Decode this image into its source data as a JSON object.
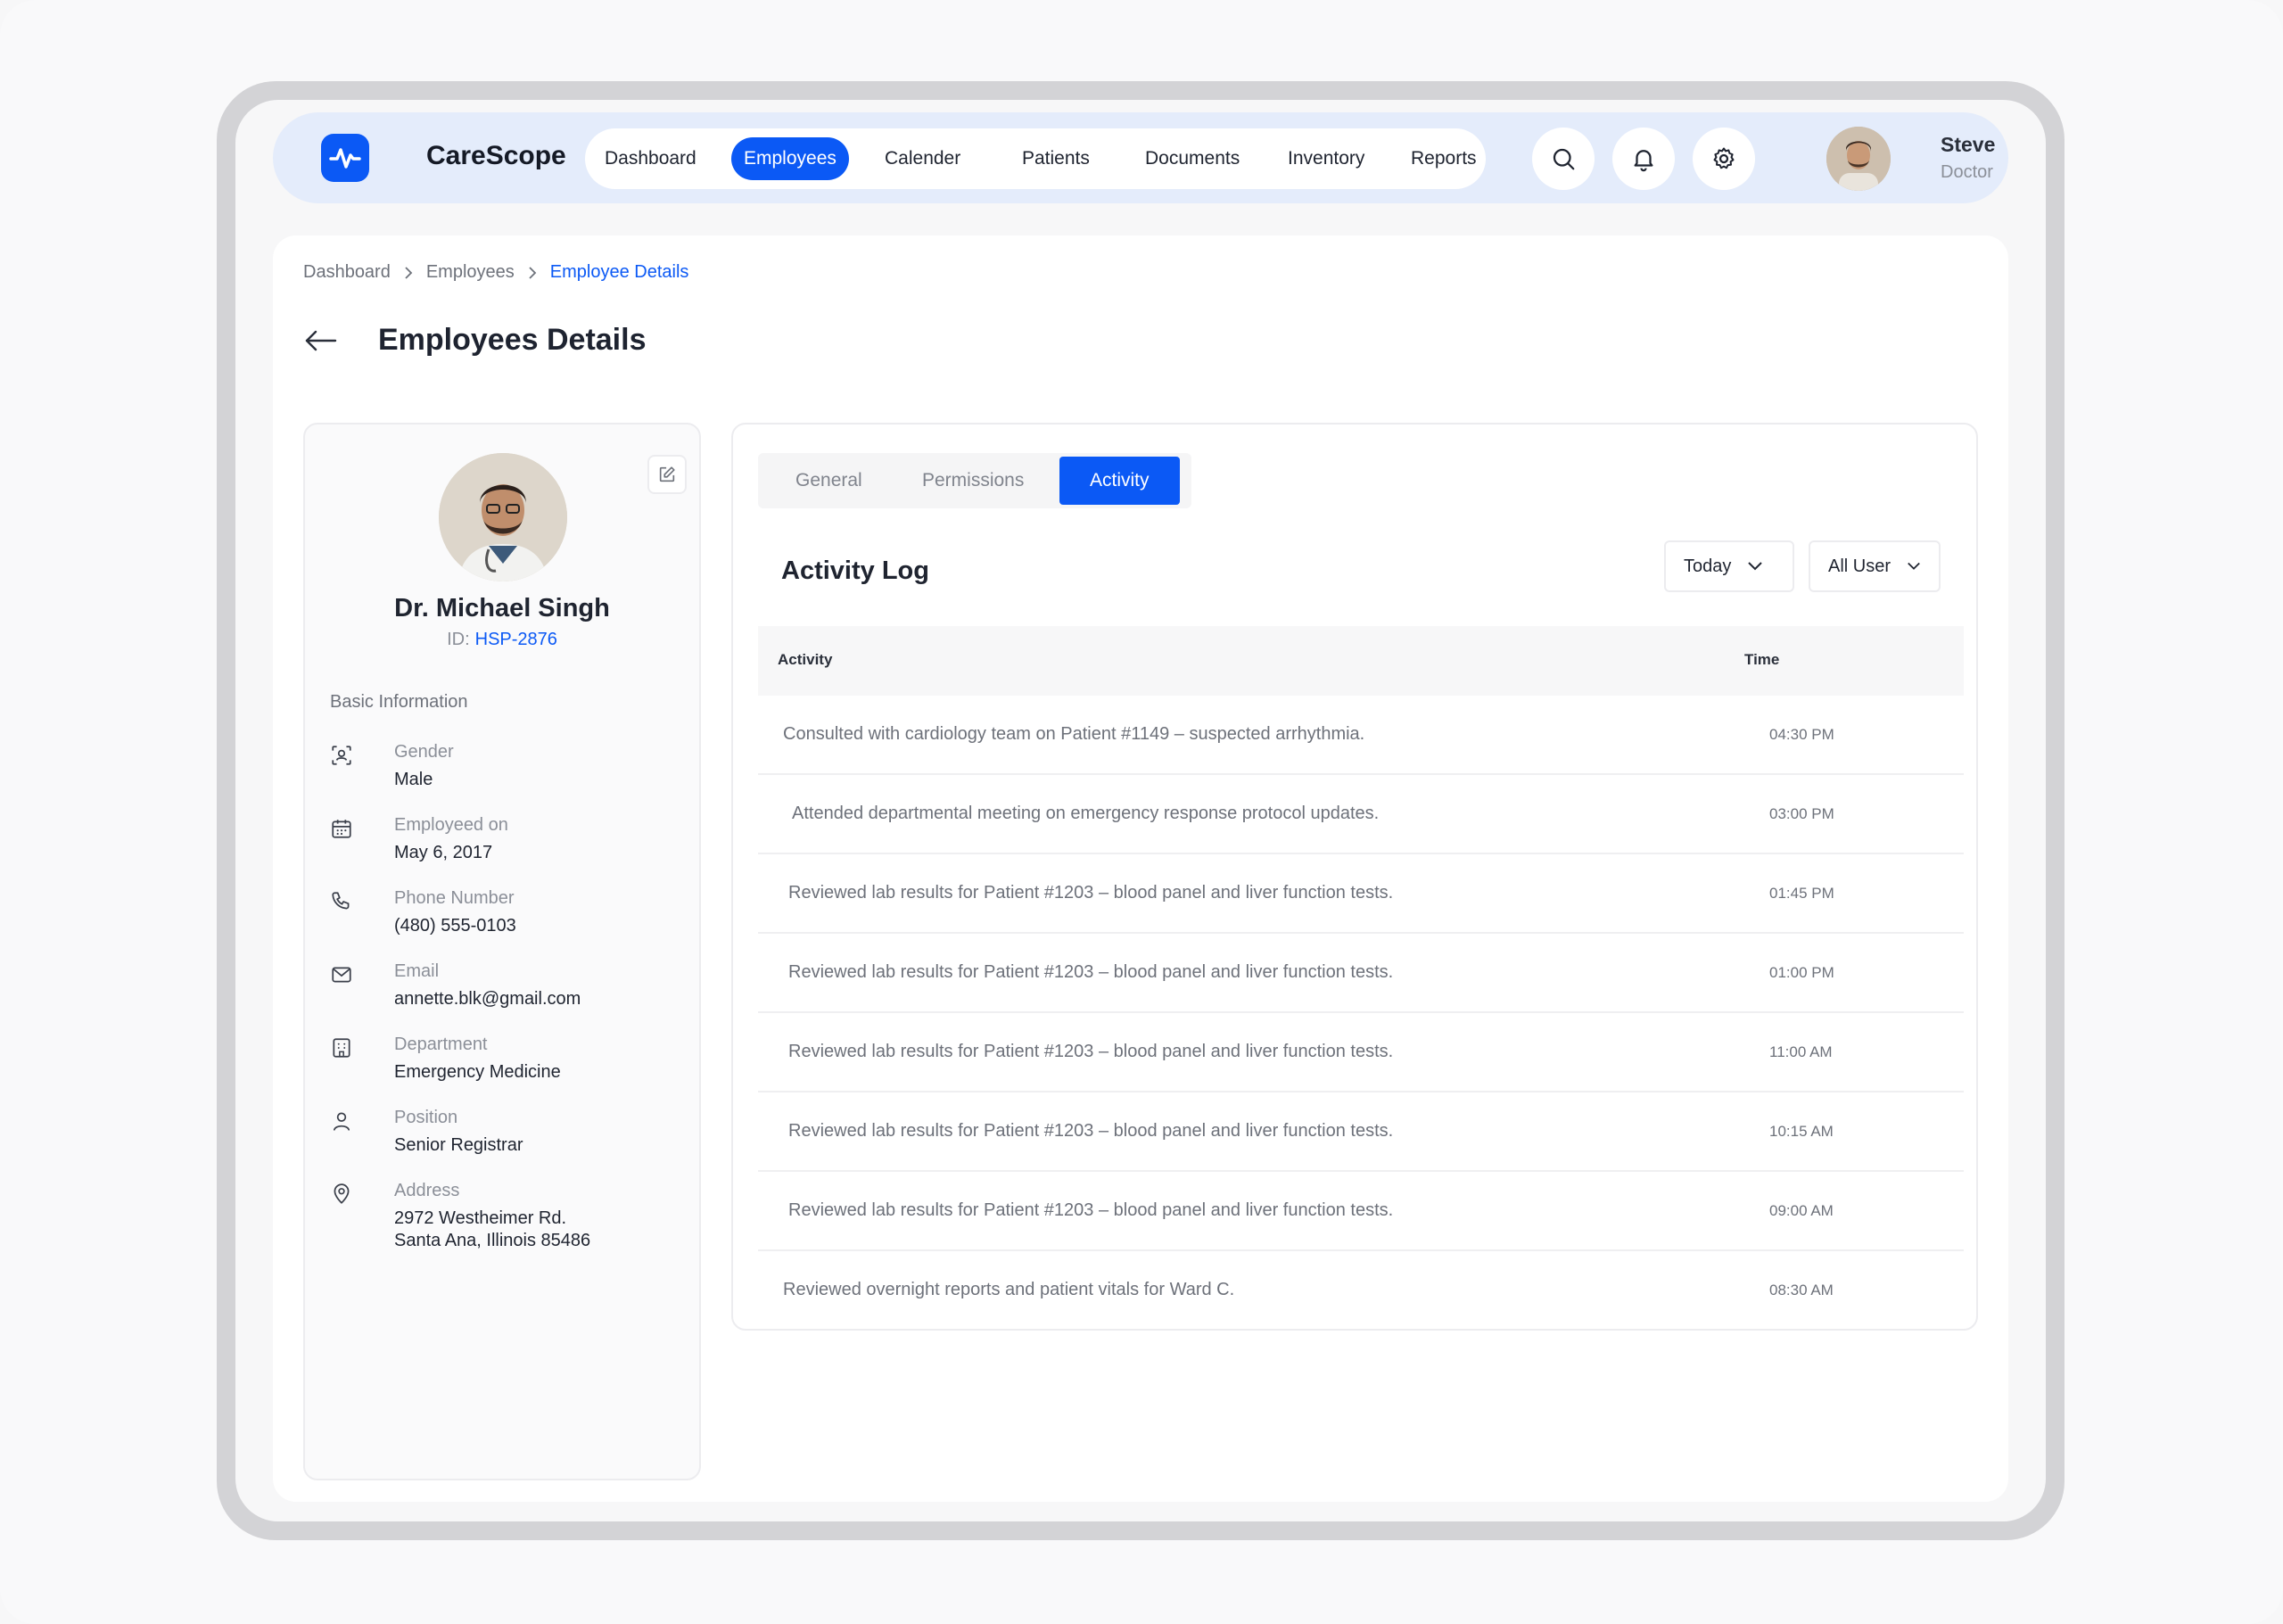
{
  "app": {
    "brand": "CareScope"
  },
  "nav": {
    "items": [
      {
        "label": "Dashboard",
        "active": false
      },
      {
        "label": "Employees",
        "active": true
      },
      {
        "label": "Calender",
        "active": false
      },
      {
        "label": "Patients",
        "active": false
      },
      {
        "label": "Documents",
        "active": false
      },
      {
        "label": "Inventory",
        "active": false
      },
      {
        "label": "Reports",
        "active": false
      }
    ],
    "icons": [
      "search-icon",
      "bell-icon",
      "gear-icon"
    ]
  },
  "user": {
    "name": "Steve",
    "role": "Doctor"
  },
  "breadcrumb": [
    "Dashboard",
    "Employees",
    "Employee Details"
  ],
  "page": {
    "title": "Employees Details"
  },
  "profile": {
    "name": "Dr. Michael Singh",
    "id_label": "ID:",
    "id_value": "HSP-2876",
    "section_title": "Basic Information",
    "fields": [
      {
        "icon": "gender-icon",
        "label": "Gender",
        "value": "Male"
      },
      {
        "icon": "calendar-icon",
        "label": "Employeed on",
        "value": "May 6, 2017"
      },
      {
        "icon": "phone-icon",
        "label": "Phone Number",
        "value": "(480) 555-0103"
      },
      {
        "icon": "mail-icon",
        "label": "Email",
        "value": "annette.blk@gmail.com"
      },
      {
        "icon": "building-icon",
        "label": "Department",
        "value": "Emergency Medicine"
      },
      {
        "icon": "person-icon",
        "label": "Position",
        "value": "Senior Registrar"
      },
      {
        "icon": "location-icon",
        "label": "Address",
        "value": "2972 Westheimer Rd.",
        "value2": "Santa Ana, Illinois 85486"
      }
    ]
  },
  "tabs": [
    {
      "label": "General",
      "active": false
    },
    {
      "label": "Permissions",
      "active": false
    },
    {
      "label": "Activity",
      "active": true
    }
  ],
  "activity_log": {
    "title": "Activity Log",
    "filters": {
      "date": "Today",
      "user": "All User"
    },
    "columns": {
      "activity": "Activity",
      "time": "Time"
    },
    "rows": [
      {
        "activity": "Consulted with cardiology team on Patient #1149 – suspected arrhythmia.",
        "time": "04:30 PM"
      },
      {
        "activity": "Attended departmental meeting on emergency response protocol updates.",
        "time": "03:00 PM"
      },
      {
        "activity": "Reviewed lab results for Patient #1203 – blood panel and liver function tests.",
        "time": "01:45 PM"
      },
      {
        "activity": "Reviewed lab results for Patient #1203 – blood panel and liver function tests.",
        "time": "01:00 PM"
      },
      {
        "activity": "Reviewed lab results for Patient #1203 – blood panel and liver function tests.",
        "time": "11:00 AM"
      },
      {
        "activity": "Reviewed lab results for Patient #1203 – blood panel and liver function tests.",
        "time": "10:15 AM"
      },
      {
        "activity": "Reviewed lab results for Patient #1203 – blood panel and liver function tests.",
        "time": "09:00 AM"
      },
      {
        "activity": "Reviewed overnight reports and patient vitals for Ward C.",
        "time": "08:30 AM"
      }
    ]
  },
  "colors": {
    "accent": "#0b59f5",
    "topbar": "#e4ecfb"
  }
}
